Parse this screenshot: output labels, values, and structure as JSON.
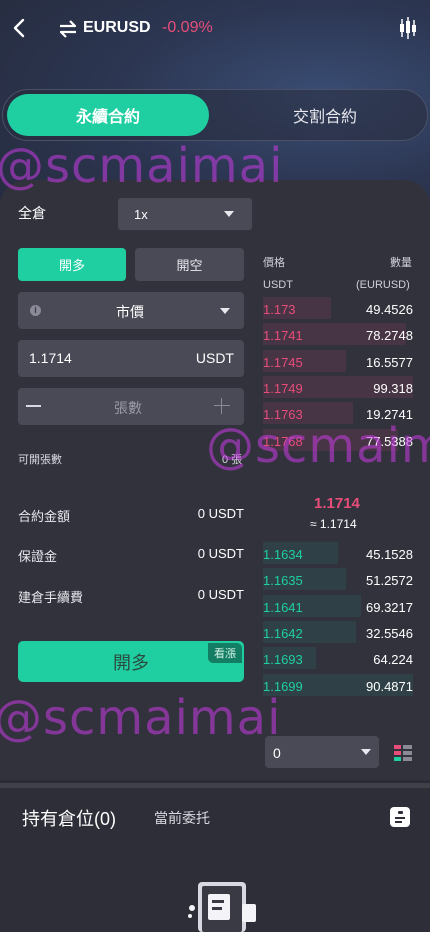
{
  "header": {
    "symbol": "EURUSD",
    "change": "-0.09%"
  },
  "tabs": [
    {
      "label": "永續合約",
      "active": true
    },
    {
      "label": "交割合約",
      "active": false
    }
  ],
  "form": {
    "margin_mode": "全倉",
    "leverage": "1x",
    "long_label": "開多",
    "short_label": "開空",
    "order_type": "市價",
    "price_value": "1.1714",
    "price_unit": "USDT",
    "quantity_placeholder": "張數",
    "available_label": "可開張數",
    "available_value": "0 張",
    "summary": [
      {
        "label": "合約金額",
        "value": "0 USDT"
      },
      {
        "label": "保證金",
        "value": "0 USDT"
      },
      {
        "label": "建倉手續費",
        "value": "0 USDT"
      }
    ],
    "submit_label": "開多",
    "bull_tag": "看漲"
  },
  "orderbook": {
    "price_header": "價格",
    "qty_header": "數量",
    "price_unit": "USDT",
    "qty_unit": "(EURUSD)",
    "asks": [
      {
        "price": "1.173",
        "qty": "49.4526",
        "depth": 0.45
      },
      {
        "price": "1.1741",
        "qty": "78.2748",
        "depth": 0.95
      },
      {
        "price": "1.1745",
        "qty": "16.5577",
        "depth": 0.55
      },
      {
        "price": "1.1749",
        "qty": "99.318",
        "depth": 1.0
      },
      {
        "price": "1.1763",
        "qty": "19.2741",
        "depth": 0.6
      },
      {
        "price": "1.1768",
        "qty": "77.5388",
        "depth": 0.9
      }
    ],
    "mid_price": "1.1714",
    "mid_sub": "≈ 1.1714",
    "bids": [
      {
        "price": "1.1634",
        "qty": "45.1528",
        "depth": 0.5
      },
      {
        "price": "1.1635",
        "qty": "51.2572",
        "depth": 0.55
      },
      {
        "price": "1.1641",
        "qty": "69.3217",
        "depth": 0.65
      },
      {
        "price": "1.1642",
        "qty": "32.5546",
        "depth": 0.62
      },
      {
        "price": "1.1693",
        "qty": "64.224",
        "depth": 0.35
      },
      {
        "price": "1.1699",
        "qty": "90.4871",
        "depth": 1.0
      }
    ],
    "depth_select": "0"
  },
  "positions": {
    "holding_label": "持有倉位(0)",
    "orders_label": "當前委托"
  },
  "watermark": "@scmaimai",
  "colors": {
    "accent": "#1fcfa1",
    "down": "#e84d79",
    "background": "#32323d"
  }
}
